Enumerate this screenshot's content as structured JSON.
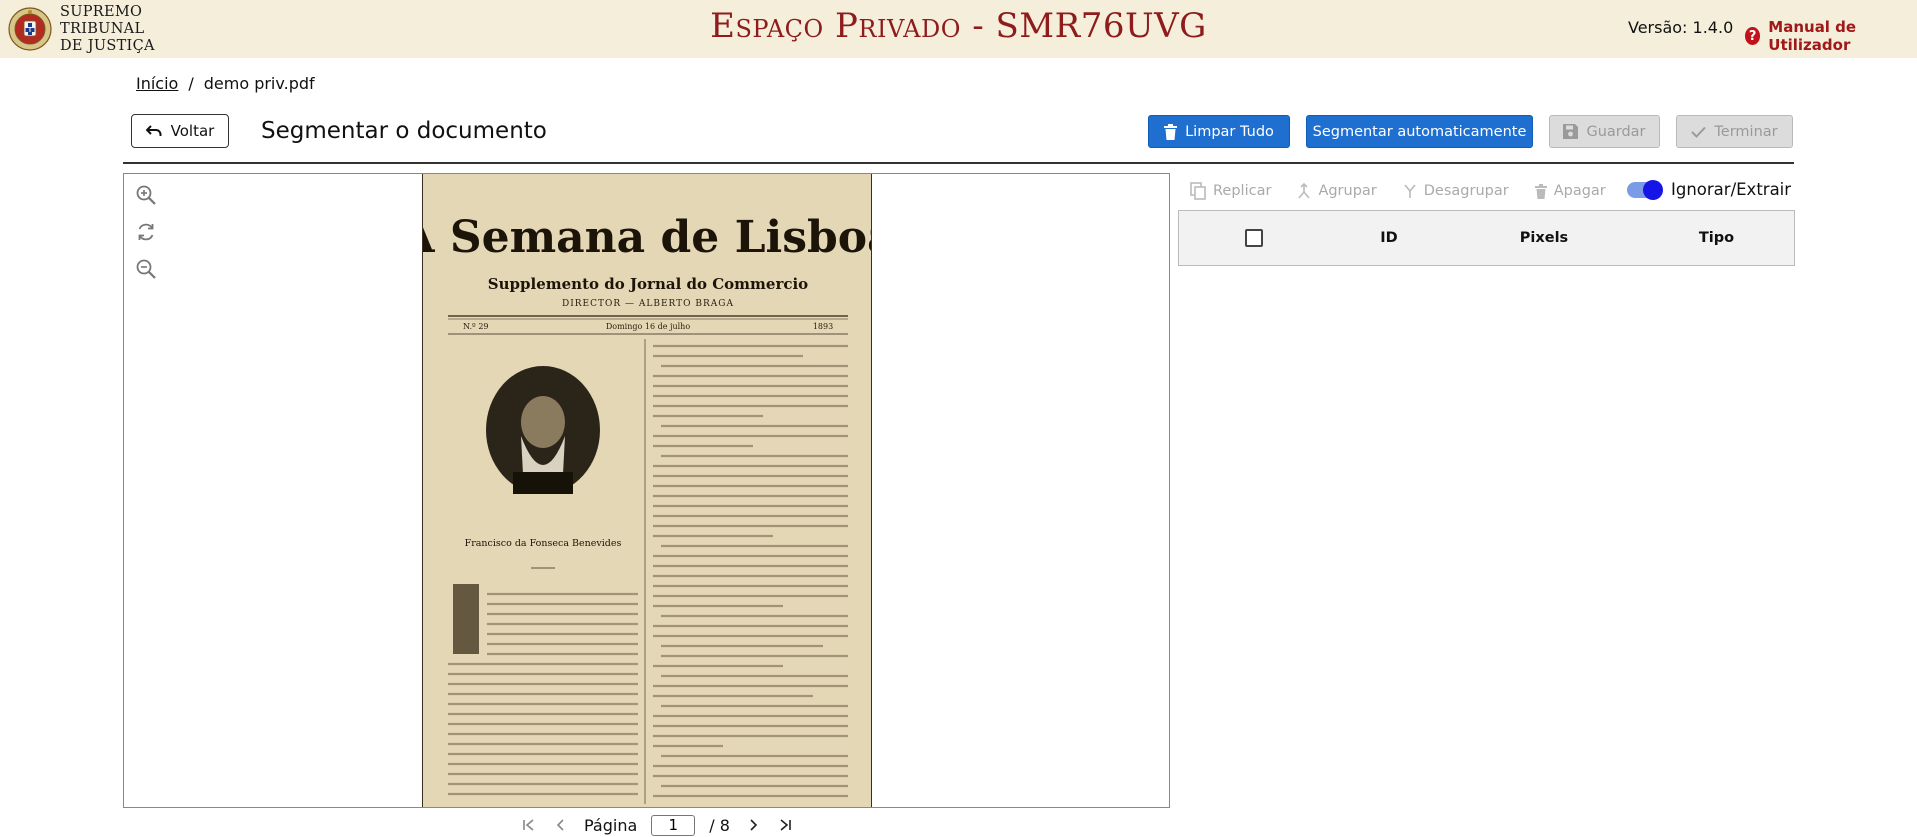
{
  "header": {
    "logo_lines": [
      "SUPREMO",
      "TRIBUNAL",
      "DE JUSTIÇA"
    ],
    "title": "Espaço Privado - SMR76UVG",
    "version": "Versão: 1.4.0",
    "manual_label": "Manual de Utilizador",
    "help_icon": "?"
  },
  "breadcrumb": {
    "home": "Início",
    "separator": "/",
    "current": "demo priv.pdf"
  },
  "toolbar": {
    "back_label": "Voltar",
    "heading": "Segmentar o documento",
    "clear_label": "Limpar Tudo",
    "auto_label": "Segmentar automaticamente",
    "save_label": "Guardar",
    "finish_label": "Terminar"
  },
  "pager": {
    "label": "Página",
    "current_page": "1",
    "total": "/ 8"
  },
  "segments": {
    "replicate": "Replicar",
    "group": "Agrupar",
    "ungroup": "Desagrupar",
    "delete": "Apagar",
    "toggle_label": "Ignorar/Extrair",
    "toggle_on": true,
    "columns": [
      "ID",
      "Pixels",
      "Tipo"
    ]
  },
  "document": {
    "masthead": "A Semana de Lisboa",
    "subtitle": "Supplemento do Jornal do Commercio",
    "director": "DIRECTOR — ALBERTO BRAGA",
    "issue": "N.º 29",
    "date": "Domingo 16 de julho",
    "year": "1893",
    "caption": "Francisco da Fonseca Benevides"
  },
  "colors": {
    "header_bg": "#f4eedb",
    "title_red": "#8e1c1c",
    "primary_blue": "#1f6fd1",
    "toggle_blue": "#1515e8"
  }
}
